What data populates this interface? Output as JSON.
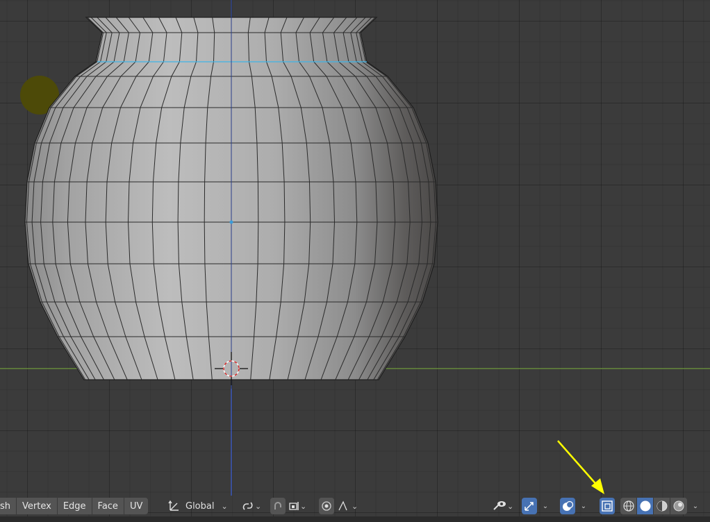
{
  "toolbar": {
    "mode_partial_label": "sh",
    "select_modes": [
      "Vertex",
      "Edge",
      "Face",
      "UV"
    ],
    "transform_orientation": "Global",
    "chevron": "⌄"
  },
  "icons": {
    "orientation": "transform-orientation-icon",
    "pivot": "pivot-point-icon",
    "snap": "snap-magnet-icon",
    "snap_target": "snap-increment-icon",
    "proportional": "proportional-editing-icon",
    "falloff": "falloff-curve-icon",
    "visibility": "object-visibility-icon",
    "gizmo": "gizmo-icon",
    "overlays": "overlays-icon",
    "xray": "xray-toggle-icon",
    "shading": [
      "wireframe-shading-icon",
      "solid-shading-icon",
      "material-shading-icon",
      "rendered-shading-icon"
    ]
  },
  "colors": {
    "accent": "#4772b3",
    "annotation_arrow": "#ffff00",
    "x_axis": "#6f9b3e",
    "z_axis": "#3b5fd8",
    "mesh_edge_highlight": "#3fb4e6"
  },
  "xray_active": true,
  "active_shading": "solid"
}
